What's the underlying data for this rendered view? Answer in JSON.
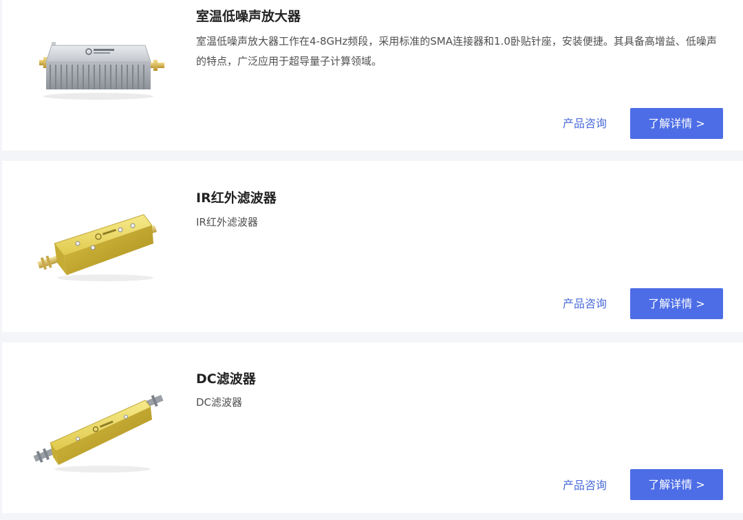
{
  "products": [
    {
      "title": "室温低噪声放大器",
      "description": "室温低噪声放大器工作在4-8GHz频段，采用标准的SMA连接器和1.0卧贴针座，安装便捷。其具备高增益、低噪声的特点，广泛应用于超导量子计算领域。",
      "consult_label": "产品咨询",
      "detail_label": "了解详情 >",
      "image_icon": "amplifier-image"
    },
    {
      "title": "IR红外滤波器",
      "description": "IR红外滤波器",
      "consult_label": "产品咨询",
      "detail_label": "了解详情 >",
      "image_icon": "ir-filter-image"
    },
    {
      "title": "DC滤波器",
      "description": "DC滤波器",
      "consult_label": "产品咨询",
      "detail_label": "了解详情 >",
      "image_icon": "dc-filter-image"
    }
  ],
  "colors": {
    "page_background": "#f4f5f8",
    "card_background": "#ffffff",
    "button_background": "#4d6de6",
    "link_color": "#4a6bd9",
    "title_color": "#222222",
    "description_color": "#4f4f4f",
    "gold_body": "#e6d45a",
    "silver_body": "#c9ccd1"
  }
}
